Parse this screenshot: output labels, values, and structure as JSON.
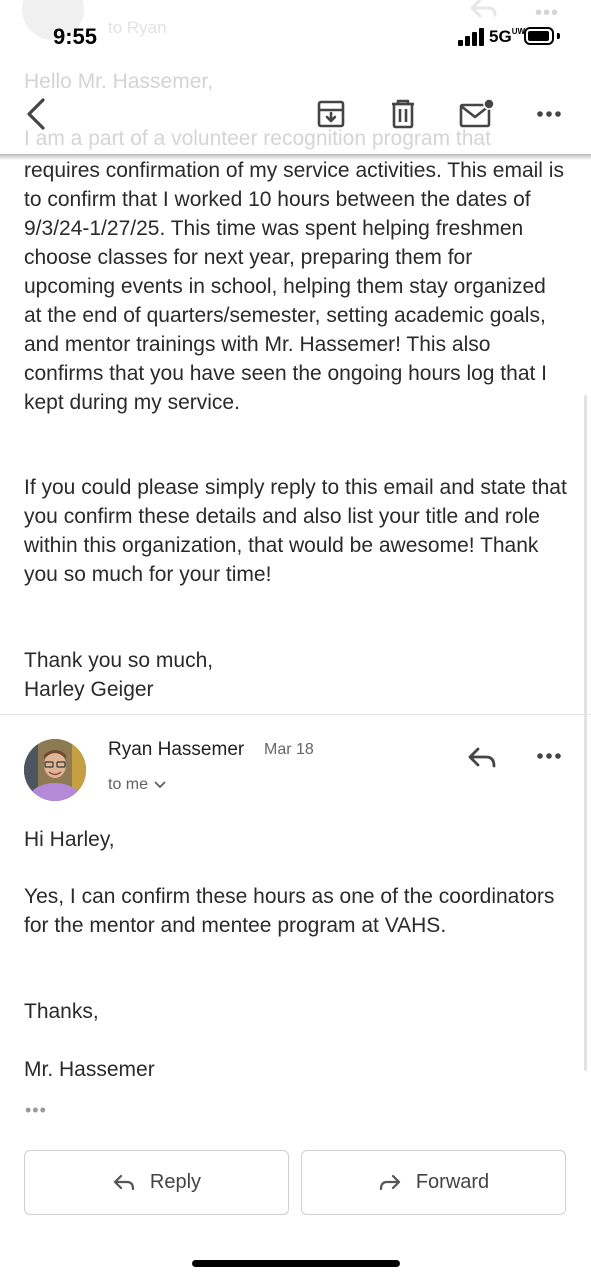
{
  "status": {
    "time": "9:55",
    "network": "5G",
    "network_sub": "UW",
    "signal_bars": 4,
    "battery_level": 0.85
  },
  "toolbar": {
    "back_icon": "chevron-left-icon",
    "archive_icon": "archive-icon",
    "delete_icon": "trash-icon",
    "mark_unread_icon": "mail-unread-icon",
    "more_icon": "more-horizontal-icon"
  },
  "faded": {
    "to_text": "to Ryan",
    "hello": "Hello Mr. Hassemer,",
    "first_line": "I am a part of a volunteer recognition program that"
  },
  "first_message": {
    "paragraph1": "requires confirmation of my service activities. This email is to confirm that I worked 10 hours between the dates of 9/3/24-1/27/25. This time was spent helping freshmen choose classes for next year, preparing them for upcoming events in school, helping them stay organized at the end of quarters/semester, setting academic goals, and mentor trainings with Mr. Hassemer! This also confirms that you have seen the ongoing hours log that I kept during my service.",
    "paragraph2": "If you could please simply reply to this email and state that you confirm these details and also list your title and role within this organization, that would be awesome! Thank you so much for your time!",
    "closing": "Thank you so much,",
    "signature": "Harley Geiger"
  },
  "reply_message": {
    "sender": "Ryan Hassemer",
    "date": "Mar 18",
    "to": "to me",
    "greeting": "Hi Harley,",
    "body": "Yes, I can confirm these hours as one of the coordinators for the mentor and mentee program at VAHS.",
    "thanks": "Thanks,",
    "signature": "Mr. Hassemer",
    "quoted_toggle": "•••"
  },
  "actions": {
    "reply": "Reply",
    "forward": "Forward"
  },
  "colors": {
    "text": "#2a2a2a",
    "muted": "#666666",
    "divider": "#e4e4e4"
  }
}
